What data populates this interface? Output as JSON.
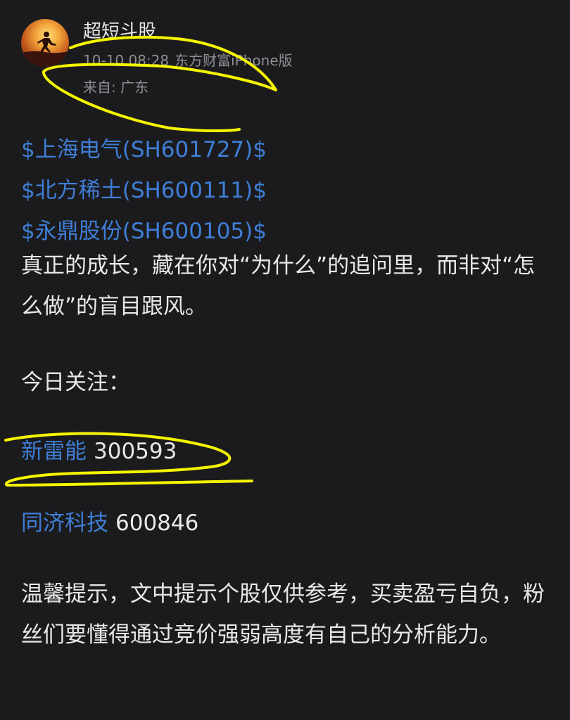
{
  "post": {
    "author": "超短斗股",
    "date": "10-10 08:28",
    "client": "东方财富iPhone版",
    "location": "来自: 广东"
  },
  "tags": [
    "$上海电气(SH601727)$",
    "$北方稀土(SH600111)$",
    "$永鼎股份(SH600105)$"
  ],
  "quote": "真正的成长，藏在你对“为什么”的追问里，而非对“怎么做”的盲目跟风。",
  "focus": {
    "title": "今日关注：",
    "items": [
      {
        "name": "新雷能",
        "code": "300593"
      },
      {
        "name": "同济科技",
        "code": "600846"
      }
    ]
  },
  "disclaimer": "温馨提示，文中提示个股仅供参考，买卖盈亏自负，粉丝们要懂得通过竞价强弱高度有自己的分析能力。",
  "colors": {
    "background": "#1b1b1d",
    "link": "#3f7ed6",
    "text": "#e8e8e8",
    "meta": "#8e8e93",
    "annotation": "#f5f500"
  }
}
